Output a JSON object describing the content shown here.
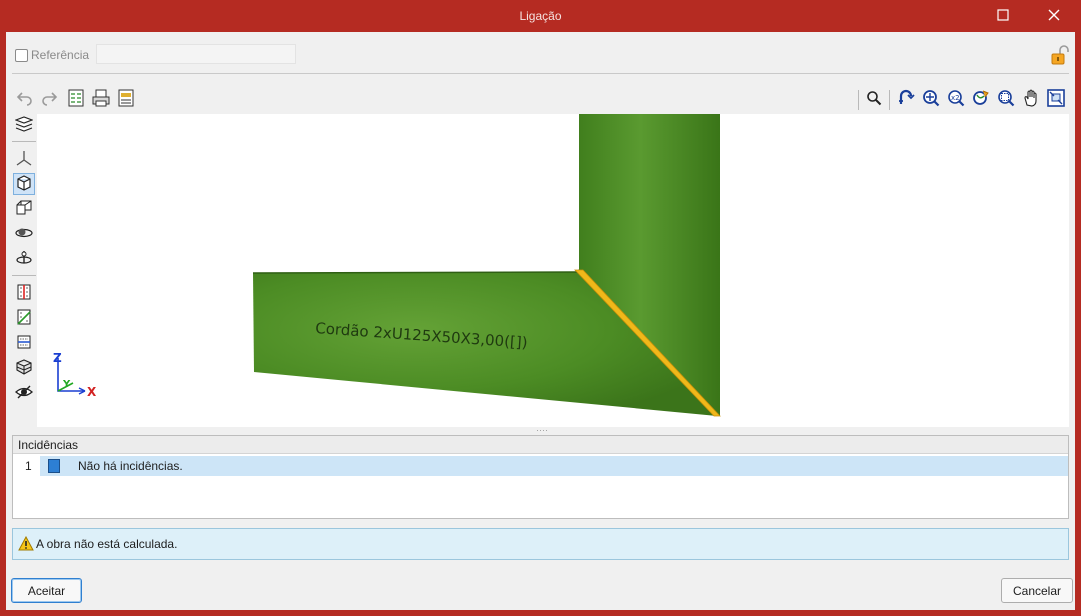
{
  "window": {
    "title": "Ligação",
    "maximize_icon": "maximize-icon",
    "close_icon": "close-icon",
    "frame_color": "#b52b22"
  },
  "reference": {
    "label": "Referência",
    "checked": false,
    "value": ""
  },
  "toolbar": {
    "left_icons": [
      "undo-icon",
      "redo-icon",
      "list-check-icon",
      "print-icon",
      "export-icon"
    ],
    "right_icons": [
      "search-icon",
      "zoom-rotate-icon",
      "zoom-all-icon",
      "zoom-window-icon",
      "rotate-icon",
      "zoom-out-icon",
      "pan-hand-icon",
      "fit-view-icon"
    ]
  },
  "side_toolbar": {
    "icons": [
      "layers-icon",
      "axes-icon",
      "view-3d-icon",
      "view-cube-icon",
      "orbit-icon",
      "pivot-icon",
      "section-red-icon",
      "section-green-icon",
      "section-blue-icon",
      "solid-icon",
      "visibility-icon"
    ],
    "active": "view-3d-icon"
  },
  "viewport": {
    "annotation": "Cordão 2xU125X50X3,00([])",
    "axis_z": "Z",
    "axis_y": "Y",
    "axis_x": "X",
    "member_color": "#4a8a23",
    "weld_color": "#f0b81a"
  },
  "incidences": {
    "title": "Incidências",
    "rows": [
      {
        "number": "1",
        "text": "Não há incidências."
      }
    ]
  },
  "status": {
    "icon": "warning-icon",
    "text": "A obra não está calculada."
  },
  "buttons": {
    "accept": "Aceitar",
    "cancel": "Cancelar"
  }
}
